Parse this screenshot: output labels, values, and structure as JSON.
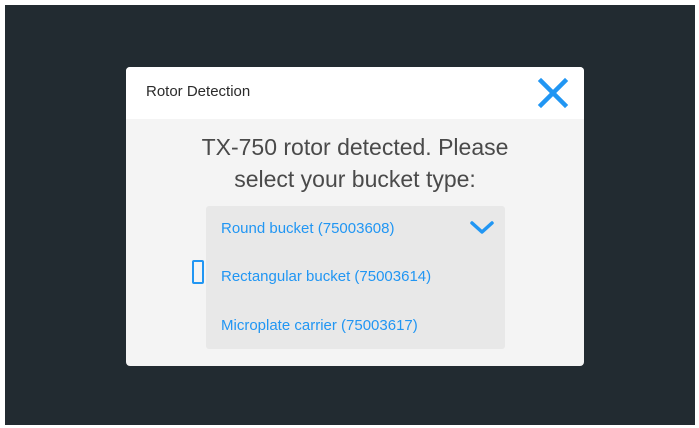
{
  "dialog": {
    "title": "Rotor Detection",
    "prompt_line1": "TX-750 rotor detected. Please",
    "prompt_line2": "select your bucket type:"
  },
  "dropdown": {
    "selected": "Round bucket (75003608)",
    "options": [
      "Round bucket (75003608)",
      "Rectangular bucket (75003614)",
      "Microplate carrier (75003617)"
    ]
  },
  "occluded_label_fragment": "s",
  "colors": {
    "accent": "#2196f3",
    "background": "#222b31",
    "dialog": "#f4f4f4",
    "dropdown": "#e8e8e8"
  },
  "icons": {
    "close": "close-icon",
    "chevron": "chevron-down-icon"
  }
}
